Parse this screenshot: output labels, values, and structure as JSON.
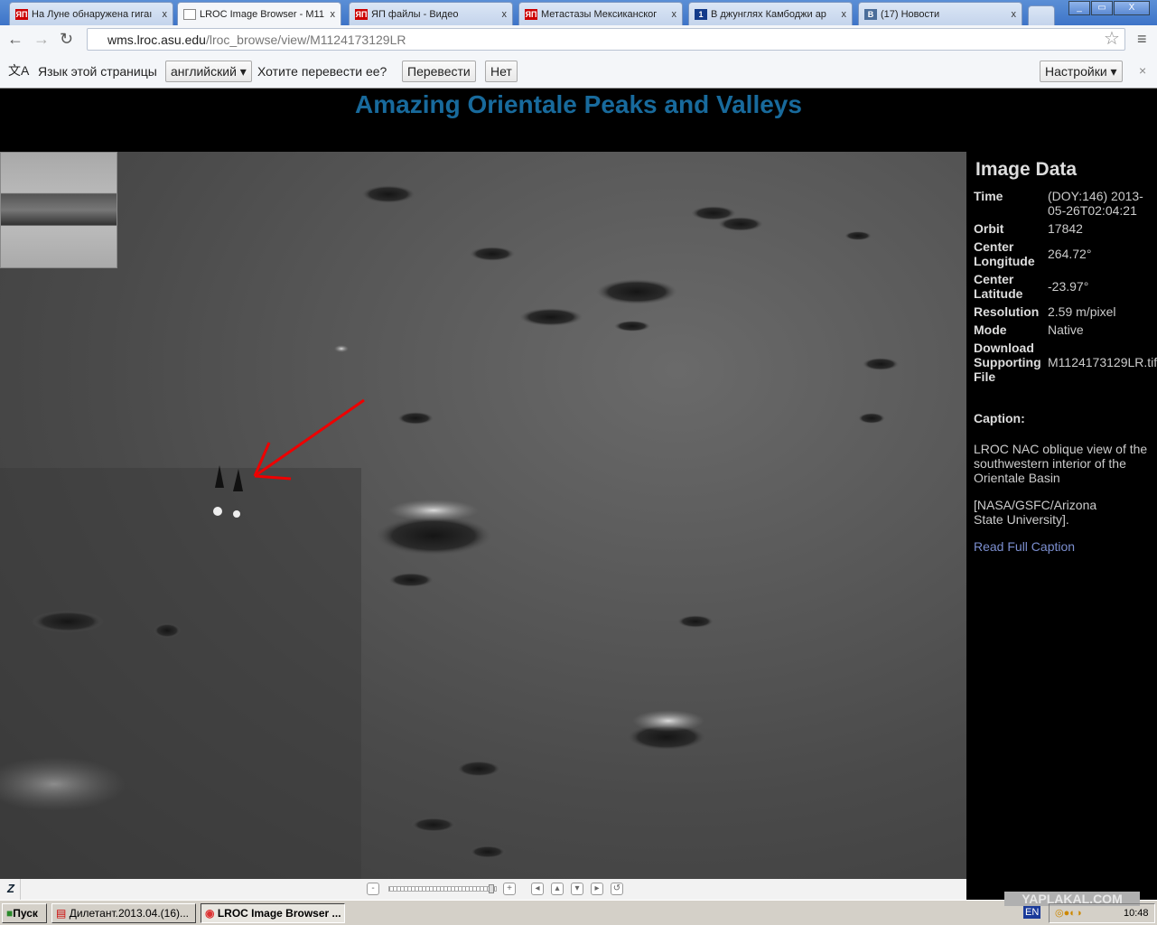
{
  "browser": {
    "tabs": [
      {
        "label": "На Луне обнаружена гигаı",
        "icon": "yaplakal-icon",
        "active": false
      },
      {
        "label": "LROC Image Browser - M11",
        "icon": "page-icon",
        "active": true
      },
      {
        "label": "ЯП файлы - Видео",
        "icon": "yaplakal-icon",
        "active": false
      },
      {
        "label": "Метастазы Мексиканског",
        "icon": "yaplakal-icon",
        "active": false
      },
      {
        "label": "В джунглях Камбоджи ар",
        "icon": "channel-one-icon",
        "active": false
      },
      {
        "label": "(17) Новости",
        "icon": "vk-icon",
        "active": false
      }
    ],
    "url_host": "wms.lroc.asu.edu",
    "url_path": "/lroc_browse/view/M1124173129LR",
    "close_glyph": "x"
  },
  "translate_bar": {
    "page_language_label": "Язык этой страницы",
    "language": "английский",
    "question": "Хотите перевести ее?",
    "translate_button": "Перевести",
    "no_button": "Нет",
    "settings_button": "Настройки"
  },
  "page": {
    "title": "Amazing Orientale Peaks and Valleys",
    "panel_title": "Image Data",
    "fields": [
      {
        "key": "Time",
        "value": "(DOY:146) 2013-05-26T02:04:21"
      },
      {
        "key": "Orbit",
        "value": "17842"
      },
      {
        "key": "Center Longitude",
        "value": "264.72°"
      },
      {
        "key": "Center Latitude",
        "value": "-23.97°"
      },
      {
        "key": "Resolution",
        "value": "2.59 m/pixel"
      },
      {
        "key": "Mode",
        "value": "Native"
      },
      {
        "key": "Download Supporting File",
        "value": "M1124173129LR.tif"
      }
    ],
    "caption_label": "Caption:",
    "caption": "LROC NAC oblique view of the southwestern interior of the Orientale Basin",
    "credit": "[NASA/GSFC/Arizona State University].",
    "read_full_caption": "Read Full Caption",
    "zoom_logo": "Z",
    "zoom_minus": "-",
    "zoom_plus": "+",
    "zoom_level": 0.95
  },
  "taskbar": {
    "start": "Пуск",
    "tasks": [
      "Дилетант.2013.04.(16)...",
      "LROC Image Browser ..."
    ],
    "lang": "EN",
    "clock": "10:48",
    "watermark": "YAPLAKAL.COM"
  }
}
